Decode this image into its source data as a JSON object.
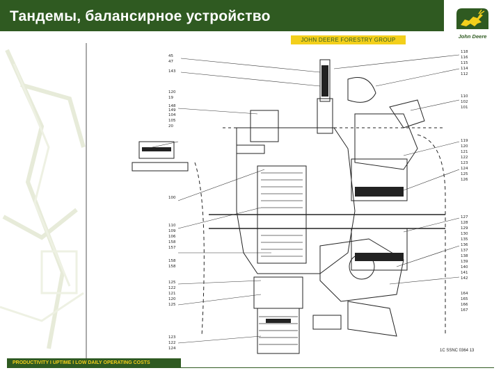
{
  "header": {
    "title": "Тандемы, балансирное устройство",
    "group_label": "JOHN DEERE FORESTRY GROUP",
    "logo_text": "John Deere",
    "logo_icon": "deer-icon"
  },
  "diagram": {
    "code": "1C SSNC 0364 13",
    "callouts_left": [
      "45",
      "47",
      "143",
      "148",
      "149",
      "120",
      "19",
      "104",
      "105",
      "20",
      "104",
      "155",
      "100",
      "110",
      "109",
      "106",
      "158",
      "157",
      "158",
      "158",
      "125",
      "122",
      "121",
      "120",
      "125",
      "123",
      "122",
      "124"
    ],
    "callouts_right": [
      "118",
      "116",
      "115",
      "114",
      "112",
      "110",
      "102",
      "101",
      "119",
      "120",
      "121",
      "122",
      "123",
      "124",
      "125",
      "126",
      "127",
      "128",
      "129",
      "130",
      "135",
      "136",
      "137",
      "138",
      "139",
      "140",
      "141",
      "142",
      "164",
      "165",
      "166",
      "167"
    ]
  },
  "footer": {
    "slogan": "PRODUCTIVITY  I  UPTIME  I  LOW DAILY OPERATING COSTS"
  },
  "colors": {
    "brand_green": "#2f5a21",
    "brand_yellow": "#f3cf1b"
  }
}
